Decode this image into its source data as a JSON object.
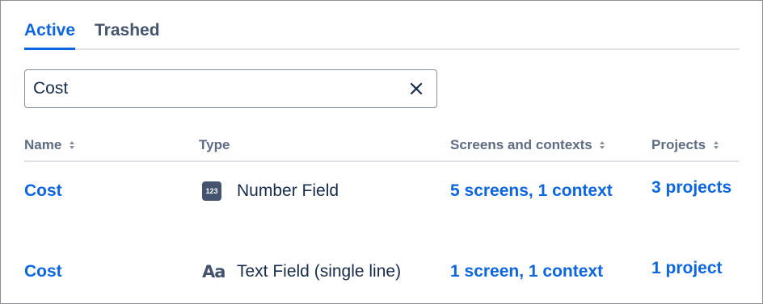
{
  "tabs": [
    {
      "label": "Active"
    },
    {
      "label": "Trashed"
    }
  ],
  "search": {
    "value": "Cost",
    "clear_icon": "close-icon"
  },
  "table": {
    "columns": [
      "Name",
      "Type",
      "Screens and contexts",
      "Projects"
    ],
    "rows": [
      {
        "name": "Cost",
        "type_icon": "123",
        "type": "Number Field",
        "screens": "5 screens, 1 context",
        "projects": "3 projects"
      },
      {
        "name": "Cost",
        "type_icon": "Aa",
        "type": "Text Field (single line)",
        "screens": "1 screen, 1 context",
        "projects": "1 project"
      }
    ]
  },
  "colors": {
    "link": "#0c66e4",
    "text": "#172b4d",
    "muted": "#5e6c84",
    "border": "#dfe1e6"
  }
}
